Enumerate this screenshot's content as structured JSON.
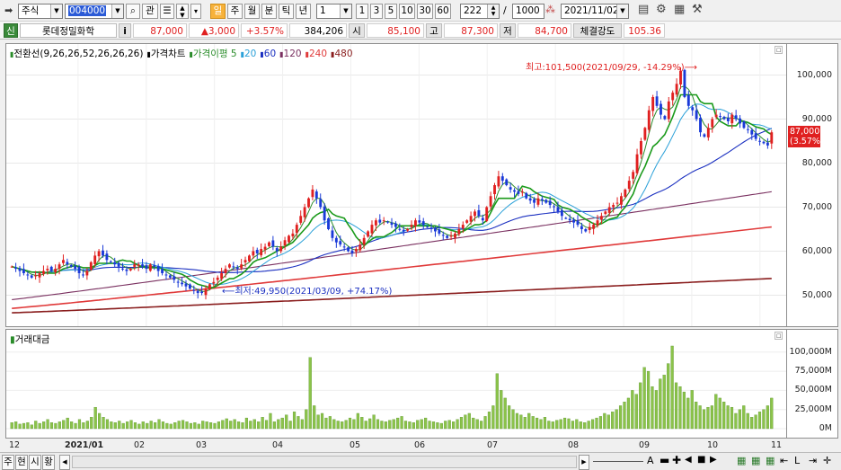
{
  "toolbar": {
    "market_select": "주식",
    "code": "004000",
    "btn_search": "⌕",
    "btn_gwan": "관",
    "periods": [
      "일",
      "주",
      "월",
      "분",
      "틱",
      "년"
    ],
    "active_period": "일",
    "multiplier": "1",
    "quick": [
      "1",
      "3",
      "5",
      "10",
      "30",
      "60"
    ],
    "count": "222",
    "sep": "/",
    "total": "1000",
    "date": "2021/11/02"
  },
  "quote": {
    "market_badge": "신",
    "name": "롯데정밀화학",
    "info": "i",
    "price": "87,000",
    "change": "▲3,000",
    "change_pct": "+3.57%",
    "volume": "384,206",
    "open_label": "시",
    "open": "85,100",
    "high_label": "고",
    "high": "87,300",
    "low_label": "저",
    "low": "84,700",
    "strength_label": "체결강도",
    "strength": "105.36"
  },
  "price_panel": {
    "legend": [
      {
        "text": "전환선(9,26,26,52,26,26,26)",
        "color": "#2a8c2a"
      },
      {
        "text": "가격차트",
        "color": "#000000"
      },
      {
        "text": "가격이평 5",
        "color": "#2a8c2a"
      },
      {
        "text": "20",
        "color": "#2aa0d8"
      },
      {
        "text": "60",
        "color": "#1a2fc0"
      },
      {
        "text": "120",
        "color": "#7a3060"
      },
      {
        "text": "240",
        "color": "#e03a3a"
      },
      {
        "text": "480",
        "color": "#8a1e1e"
      }
    ],
    "high_note": "최고:101,500(2021/09/29, -14.29%)⟶",
    "low_note": "⟵최저:49,950(2021/03/09, +74.17%)",
    "y_ticks": [
      "100,000",
      "90,000",
      "80,000",
      "70,000",
      "60,000",
      "50,000"
    ],
    "current_price_tag": "87,000",
    "current_pct_tag": "(3.57%)"
  },
  "volume_panel": {
    "legend": "거래대금",
    "y_ticks": [
      "100,000M",
      "75,000M",
      "50,000M",
      "25,000M",
      "0M"
    ]
  },
  "x_axis": [
    "12",
    "2021/01",
    "02",
    "03",
    "04",
    "05",
    "06",
    "07",
    "08",
    "09",
    "10",
    "11"
  ],
  "bottom": {
    "tabs": [
      "주",
      "현",
      "시",
      "황"
    ]
  },
  "chart_data": {
    "type": "candlestick",
    "x_range": [
      "2020/12",
      "2021/11/02"
    ],
    "y_range": [
      45000,
      105000
    ],
    "closes": [
      56500,
      56000,
      55500,
      55000,
      54500,
      54000,
      54500,
      55000,
      55500,
      56000,
      55500,
      56000,
      57000,
      58000,
      57000,
      56500,
      56000,
      55000,
      54500,
      55500,
      57500,
      59000,
      60000,
      59000,
      58000,
      57500,
      57000,
      56500,
      56000,
      55500,
      56000,
      57000,
      57000,
      56500,
      56000,
      57000,
      56500,
      55500,
      55000,
      54500,
      54000,
      53500,
      53000,
      52500,
      52000,
      51500,
      51000,
      50500,
      50500,
      51500,
      52500,
      53000,
      54000,
      55000,
      56000,
      57000,
      56500,
      56000,
      57000,
      58000,
      59000,
      60000,
      59500,
      60500,
      61000,
      62000,
      61000,
      60000,
      61000,
      62500,
      63500,
      64000,
      66000,
      68000,
      70000,
      72000,
      74000,
      72000,
      70000,
      67000,
      65000,
      63000,
      62000,
      61500,
      61000,
      60000,
      59500,
      60500,
      61500,
      63000,
      64500,
      66000,
      67000,
      66500,
      67000,
      66500,
      66000,
      65500,
      65000,
      64500,
      65000,
      66000,
      67000,
      66500,
      66000,
      65500,
      65000,
      64500,
      64000,
      63500,
      63000,
      63500,
      64000,
      65000,
      66000,
      67000,
      68000,
      69000,
      68000,
      67000,
      70000,
      72500,
      75000,
      77000,
      76000,
      75000,
      74000,
      73500,
      73000,
      73500,
      72000,
      71500,
      71000,
      72000,
      71500,
      71000,
      70500,
      70000,
      69000,
      68000,
      67500,
      67000,
      66500,
      66000,
      65000,
      64500,
      65500,
      66000,
      67000,
      68000,
      69000,
      70000,
      70500,
      71000,
      72500,
      74000,
      76000,
      78000,
      82000,
      85000,
      88000,
      92000,
      95000,
      93000,
      91000,
      90000,
      94000,
      96000,
      98000,
      101000,
      95000,
      93000,
      92000,
      90000,
      87000,
      86000,
      88000,
      90000,
      91000,
      90500,
      90000,
      89500,
      91000,
      90000,
      89000,
      88000,
      87500,
      86500,
      85500,
      85000,
      84500,
      84000,
      87000
    ],
    "volume_millions": [
      8,
      9,
      6,
      7,
      8,
      5,
      10,
      7,
      9,
      12,
      8,
      7,
      9,
      11,
      14,
      9,
      7,
      12,
      8,
      10,
      15,
      28,
      20,
      15,
      12,
      9,
      8,
      10,
      7,
      9,
      11,
      8,
      6,
      9,
      7,
      10,
      8,
      12,
      9,
      7,
      6,
      8,
      10,
      11,
      9,
      7,
      8,
      6,
      10,
      9,
      8,
      7,
      9,
      11,
      13,
      10,
      12,
      9,
      8,
      14,
      10,
      12,
      9,
      15,
      11,
      20,
      9,
      12,
      14,
      18,
      10,
      22,
      16,
      12,
      25,
      93,
      30,
      18,
      20,
      14,
      16,
      12,
      10,
      9,
      11,
      14,
      12,
      20,
      15,
      10,
      13,
      18,
      12,
      10,
      9,
      11,
      12,
      14,
      16,
      10,
      9,
      8,
      11,
      12,
      14,
      10,
      9,
      8,
      7,
      10,
      11,
      9,
      12,
      15,
      18,
      20,
      14,
      12,
      10,
      16,
      22,
      30,
      72,
      50,
      40,
      30,
      25,
      20,
      18,
      15,
      20,
      16,
      14,
      12,
      15,
      10,
      9,
      11,
      12,
      14,
      13,
      10,
      12,
      9,
      8,
      10,
      12,
      14,
      16,
      20,
      18,
      22,
      25,
      30,
      35,
      40,
      50,
      45,
      60,
      80,
      75,
      55,
      50,
      65,
      70,
      85,
      108,
      60,
      55,
      48,
      40,
      50,
      35,
      30,
      25,
      28,
      30,
      45,
      40,
      35,
      30,
      28,
      20,
      25,
      30,
      20,
      15,
      18,
      22,
      25,
      30,
      40
    ]
  }
}
